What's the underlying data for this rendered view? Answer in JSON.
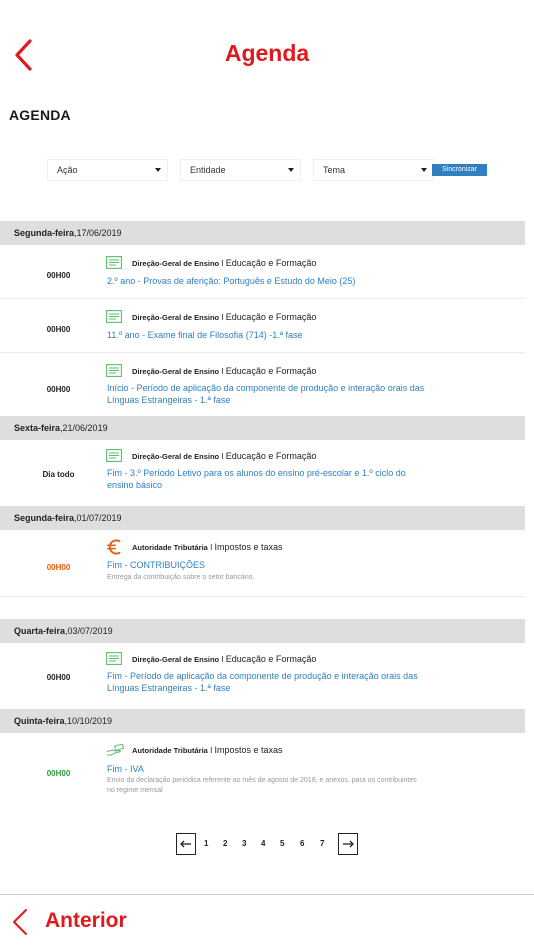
{
  "header": {
    "title": "Agenda"
  },
  "section_heading": "AGENDA",
  "filters": {
    "acao": "Ação",
    "entidade": "Entidade",
    "tema": "Tema",
    "sync_label": "Sincronizar"
  },
  "days": [
    {
      "weekday": "Segunda-feira",
      "date": ",17/06/2019",
      "events": [
        {
          "time": "00H00",
          "icon": "document-list-icon",
          "source": "Direção-Geral de Ensino",
          "sep": " I ",
          "theme": "Educação e Formação",
          "title": "2.º ano - Provas de aferição: Português e Estudo do Meio (25)"
        },
        {
          "time": "00H00",
          "icon": "document-list-icon",
          "source": "Direção-Geral de Ensino",
          "sep": " I ",
          "theme": "Educação e Formação",
          "title": "11.º ano - Exame final de Filosofia (714) -1.ª fase"
        },
        {
          "time": "00H00",
          "icon": "document-list-icon",
          "source": "Direção-Geral de Ensino",
          "sep": " I ",
          "theme": "Educação e Formação",
          "title": "Início - Período de aplicação da componente de produção e interação orais das Línguas Estrangeiras - 1.ª fase"
        }
      ]
    },
    {
      "weekday": "Sexta-feira",
      "date": ",21/06/2019",
      "events": [
        {
          "time": "Dia todo",
          "icon": "document-list-icon",
          "source": "Direção-Geral de Ensino",
          "sep": " I ",
          "theme": "Educação e Formação",
          "title": "Fim - 3.º Período Letivo para os alunos do ensino pré-escolar e 1.º ciclo do ensino básico"
        }
      ]
    },
    {
      "weekday": "Segunda-feira",
      "date": ",01/07/2019",
      "events": [
        {
          "time": "00H00",
          "icon": "euro-icon",
          "source": "Autoridade Tributária",
          "sep": " I ",
          "theme": "Impostos e taxas",
          "title": "Fim - CONTRIBUIÇÕES",
          "description": "Entrega da contribuição sobre o setor bancário."
        }
      ]
    },
    {
      "weekday": "Quarta-feira",
      "date": ",03/07/2019",
      "events": [
        {
          "time": "00H00",
          "icon": "document-list-icon",
          "source": "Direção-Geral de Ensino",
          "sep": " I ",
          "theme": "Educação e Formação",
          "title": "Fim - Período de aplicação da componente de produção e interação orais das Línguas Estrangeiras - 1.ª fase"
        }
      ]
    },
    {
      "weekday": "Quinta-feira",
      "date": ",10/10/2019",
      "events": [
        {
          "time": "00H00",
          "icon": "hand-money-icon",
          "source": "Autoridade Tributária",
          "sep": " I ",
          "theme": "Impostos e taxas",
          "title": "Fim - IVA",
          "description": "Envio da declaração periódica referente ao mês de agosto de 2018, e anexos, para os contribuintes no regime mensal"
        }
      ]
    }
  ],
  "pagination": {
    "pages": [
      "1",
      "2",
      "3",
      "4",
      "5",
      "6",
      "7"
    ],
    "prev_icon": "arrow-left-icon",
    "next_icon": "arrow-right-icon"
  },
  "footer": {
    "back_label": "Anterior"
  },
  "colors": {
    "brand_red": "#e0191e",
    "link_blue": "#2f7fc1",
    "orange": "#e8590c",
    "green": "#2e9e3a",
    "day_header_bg": "#dedede"
  }
}
